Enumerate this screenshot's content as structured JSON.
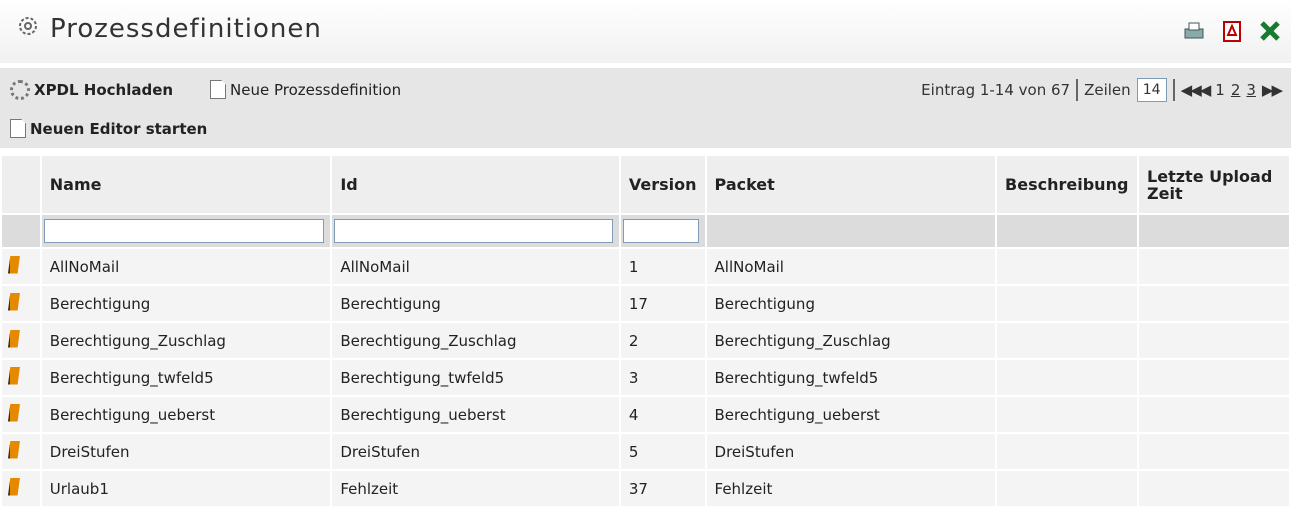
{
  "page": {
    "title": "Prozessdefinitionen"
  },
  "export": {
    "icons": [
      "print-icon",
      "pdf-icon",
      "excel-icon"
    ]
  },
  "toolbar": {
    "xpdl_upload": "XPDL Hochladen",
    "new_definition": "Neue Prozessdefinition",
    "new_editor": "Neuen Editor starten"
  },
  "pager": {
    "entries": "Eintrag 1-14 von 67",
    "rows_label": "Zeilen",
    "rows_value": "14",
    "first_prev": "◀◀◀",
    "page1": "1",
    "page2": "2",
    "page3": "3",
    "next_last": "▶▶"
  },
  "table": {
    "headers": [
      "Name",
      "Id",
      "Version",
      "Packet",
      "Beschreibung",
      "Letzte Upload Zeit"
    ],
    "rows": [
      [
        "AllNoMail",
        "AllNoMail",
        "1",
        "AllNoMail",
        "",
        ""
      ],
      [
        "Berechtigung",
        "Berechtigung",
        "17",
        "Berechtigung",
        "",
        ""
      ],
      [
        "Berechtigung_Zuschlag",
        "Berechtigung_Zuschlag",
        "2",
        "Berechtigung_Zuschlag",
        "",
        ""
      ],
      [
        "Berechtigung_twfeld5",
        "Berechtigung_twfeld5",
        "3",
        "Berechtigung_twfeld5",
        "",
        ""
      ],
      [
        "Berechtigung_ueberst",
        "Berechtigung_ueberst",
        "4",
        "Berechtigung_ueberst",
        "",
        ""
      ],
      [
        "DreiStufen",
        "DreiStufen",
        "5",
        "DreiStufen",
        "",
        ""
      ],
      [
        "Urlaub1",
        "Fehlzeit",
        "37",
        "Fehlzeit",
        "",
        ""
      ]
    ]
  },
  "colors": {
    "toolbar_bg": "#e6e6e6",
    "row_bg": "#f4f4f4",
    "pencil": "#e58a00"
  }
}
